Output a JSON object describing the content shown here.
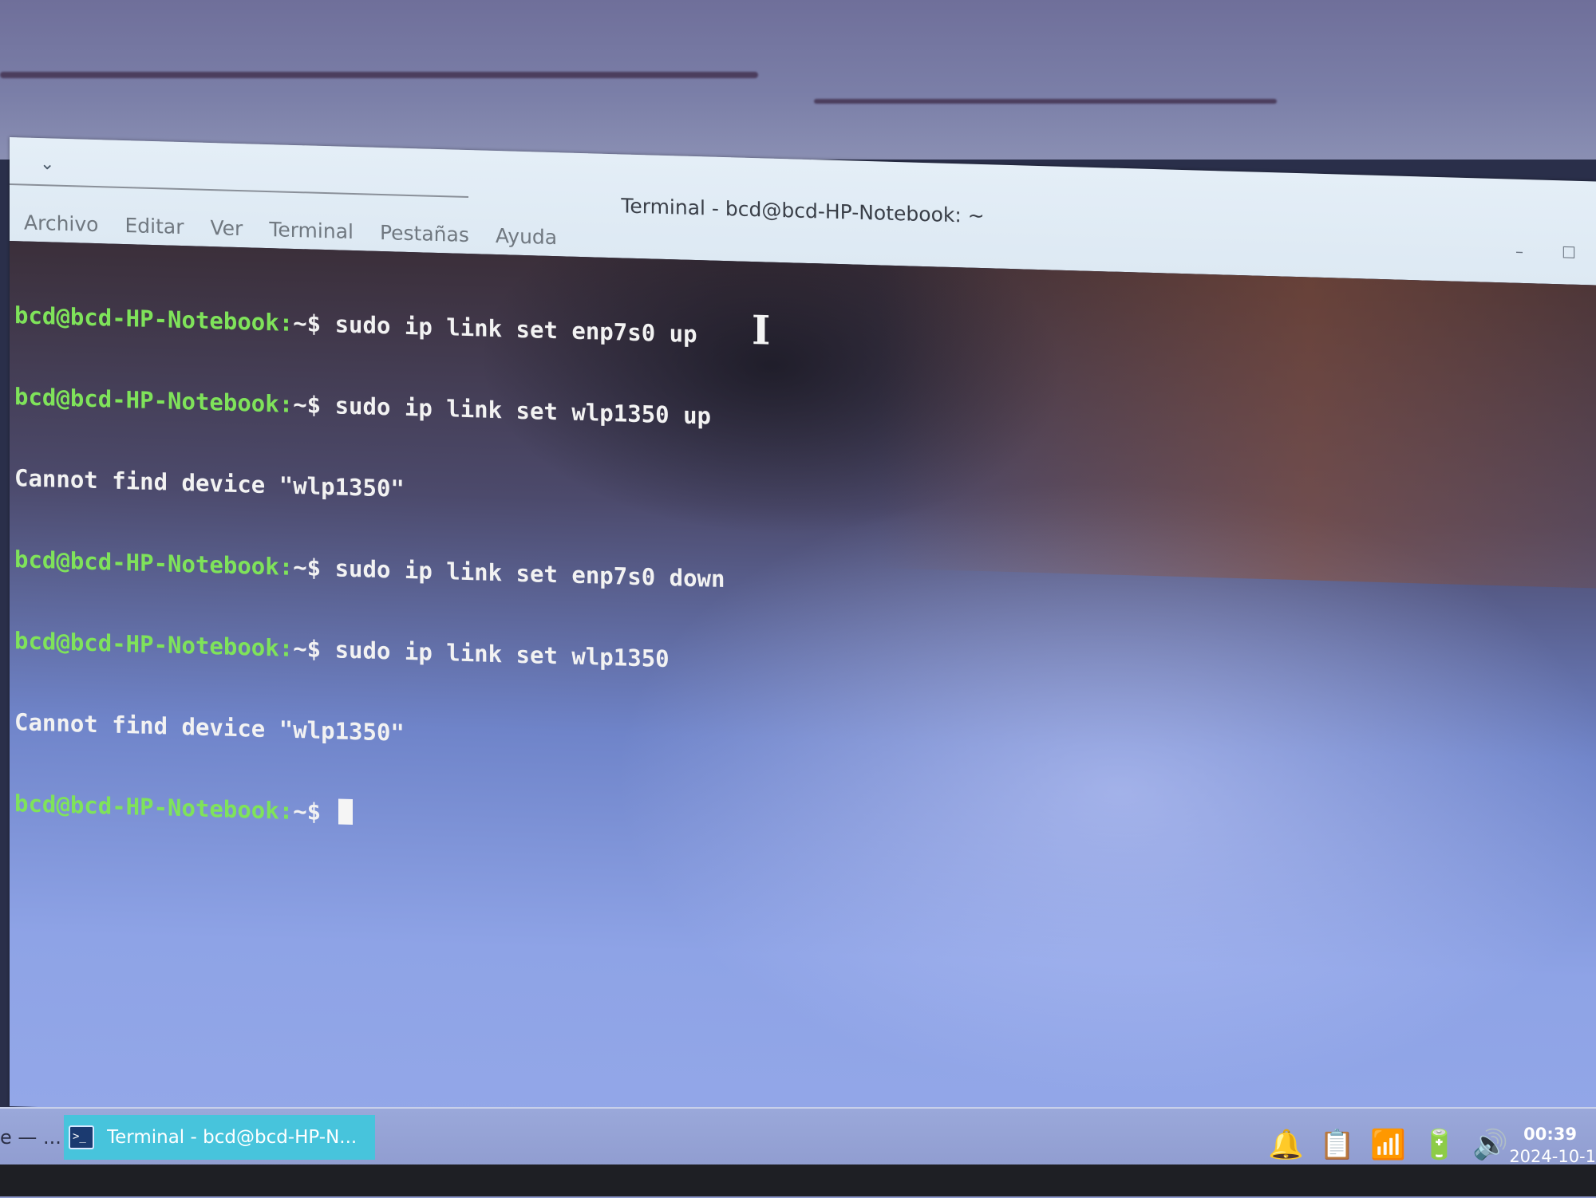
{
  "window": {
    "title": "Terminal - bcd@bcd-HP-Notebook: ~",
    "menu_toggle": "⌄",
    "minimize": "–",
    "maximize": "☐"
  },
  "menubar": [
    "Archivo",
    "Editar",
    "Ver",
    "Terminal",
    "Pestañas",
    "Ayuda"
  ],
  "terminal": {
    "lines": [
      {
        "prompt": "bcd@bcd-HP-Notebook:",
        "rest": "~$ sudo ip link set enp7s0 up"
      },
      {
        "prompt": "bcd@bcd-HP-Notebook:",
        "rest": "~$ sudo ip link set wlp1350 up"
      },
      {
        "prompt": "",
        "rest": "Cannot find device \"wlp1350\""
      },
      {
        "prompt": "bcd@bcd-HP-Notebook:",
        "rest": "~$ sudo ip link set enp7s0 down"
      },
      {
        "prompt": "bcd@bcd-HP-Notebook:",
        "rest": "~$ sudo ip link set wlp1350"
      },
      {
        "prompt": "",
        "rest": "Cannot find device \"wlp1350\""
      },
      {
        "prompt": "bcd@bcd-HP-Notebook:",
        "rest": "~$ "
      }
    ],
    "mouse_cursor": "I"
  },
  "panel": {
    "left_text": "e — ...",
    "task_label": "Terminal - bcd@bcd-HP-N...",
    "task_icon_glyph": ">_",
    "tray_icons": [
      {
        "name": "notification-bell-icon",
        "glyph": "🔔"
      },
      {
        "name": "clipboard-icon",
        "glyph": "📋"
      },
      {
        "name": "wifi-icon",
        "glyph": "📶"
      },
      {
        "name": "battery-icon",
        "glyph": "🔋"
      },
      {
        "name": "volume-icon",
        "glyph": "🔊"
      }
    ],
    "clock_time": "00:39",
    "clock_date": "2024-10-1"
  }
}
